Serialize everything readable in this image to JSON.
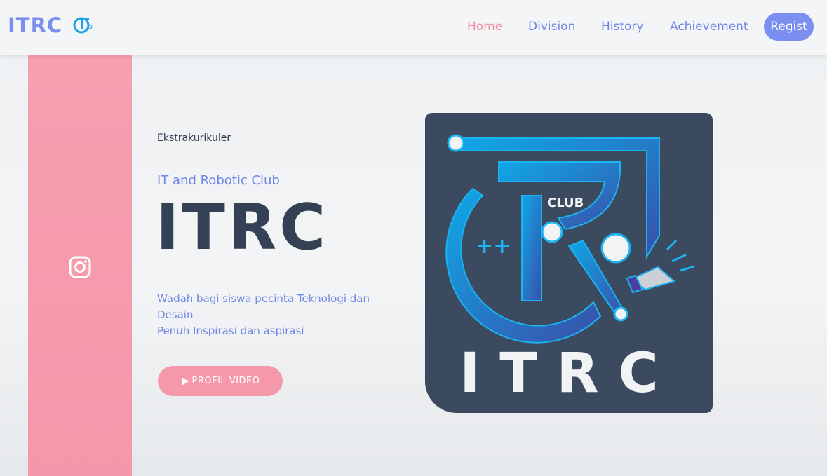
{
  "nav": {
    "brand": "ITRC",
    "items": [
      "Home",
      "Division",
      "History",
      "Achievement"
    ],
    "regist": "Regist"
  },
  "hero": {
    "eyebrow": "Ekstrakurikuler",
    "subtitle": "IT and Robotic Club",
    "title": "ITRC",
    "desc_line1": "Wadah bagi siswa pecinta Teknologi dan Desain",
    "desc_line2": "Penuh Inspirasi dan aspirasi",
    "button": "PROFIL VIDEO"
  },
  "logo": {
    "club": "CLUB",
    "text": "ITRC"
  },
  "colors": {
    "accent": "#7b8ff0",
    "pink": "#f598aa",
    "dark": "#344155"
  }
}
